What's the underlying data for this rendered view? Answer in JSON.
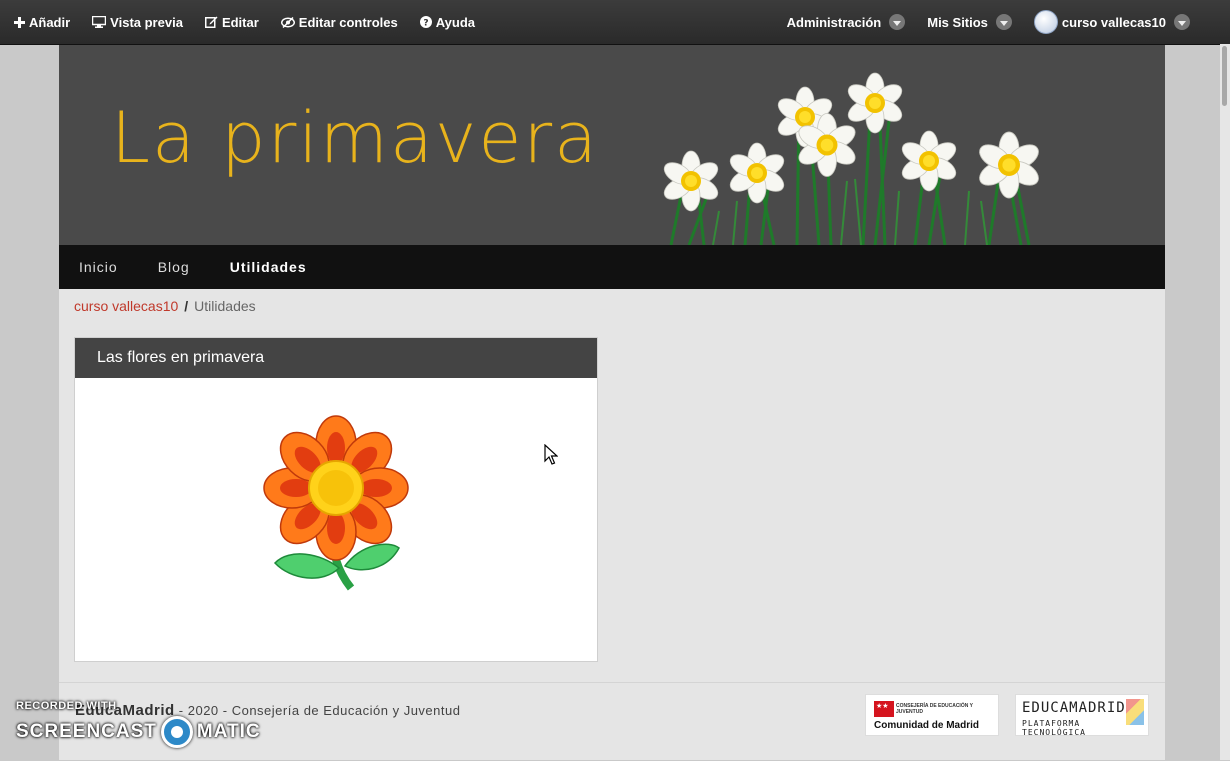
{
  "topbar": {
    "add": "Añadir",
    "preview": "Vista previa",
    "edit": "Editar",
    "edit_controls": "Editar controles",
    "help": "Ayuda",
    "admin": "Administración",
    "my_sites": "Mis Sitios",
    "user": "curso vallecas10"
  },
  "banner": {
    "title": "La primavera"
  },
  "nav": {
    "items": [
      "Inicio",
      "Blog",
      "Utilidades"
    ],
    "active": "Utilidades"
  },
  "breadcrumb": {
    "home": "curso vallecas10",
    "separator": "/",
    "current": "Utilidades"
  },
  "portlet": {
    "title": "Las flores en primavera"
  },
  "footer": {
    "brand": "EducaMadrid",
    "text": " - 2020 - Consejería de Educación y Juventud",
    "logo_cm_small": "CONSEJERÍA DE EDUCACIÓN Y JUVENTUD",
    "logo_cm_big": "Comunidad de Madrid",
    "logo_em_main": "EDUCAMADRID",
    "logo_em_sub": "PLATAFORMA TECNOLÓGICA"
  },
  "watermark": {
    "line1": "RECORDED WITH",
    "line2a": "SCREENCAST",
    "line2b": "MATIC"
  },
  "colors": {
    "title_gold": "#e8b31c",
    "link_red": "#c0392b",
    "banner_bg": "#4a4a4a"
  }
}
